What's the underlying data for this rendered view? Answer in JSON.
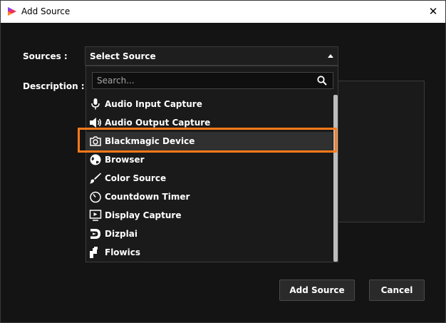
{
  "window": {
    "title": "Add Source",
    "close_glyph": "✕"
  },
  "form": {
    "sources_label": "Sources :",
    "description_label": "Description :"
  },
  "select": {
    "value": "Select Source",
    "state": "open"
  },
  "search": {
    "placeholder": "Search...",
    "value": ""
  },
  "items": [
    {
      "label": "Audio Input Capture",
      "icon": "microphone-icon"
    },
    {
      "label": "Audio Output Capture",
      "icon": "speaker-icon"
    },
    {
      "label": "Blackmagic Device",
      "icon": "camera-icon",
      "selected": true
    },
    {
      "label": "Browser",
      "icon": "globe-icon"
    },
    {
      "label": "Color Source",
      "icon": "brush-icon"
    },
    {
      "label": "Countdown Timer",
      "icon": "timer-icon"
    },
    {
      "label": "Display Capture",
      "icon": "monitor-icon"
    },
    {
      "label": "Dizplai",
      "icon": "dizplai-logo-icon"
    },
    {
      "label": "Flowics",
      "icon": "flowics-logo-icon"
    }
  ],
  "buttons": {
    "add": "Add Source",
    "cancel": "Cancel"
  },
  "colors": {
    "highlight": "#ff7a1a",
    "background": "#141414",
    "text": "#ffffff"
  }
}
